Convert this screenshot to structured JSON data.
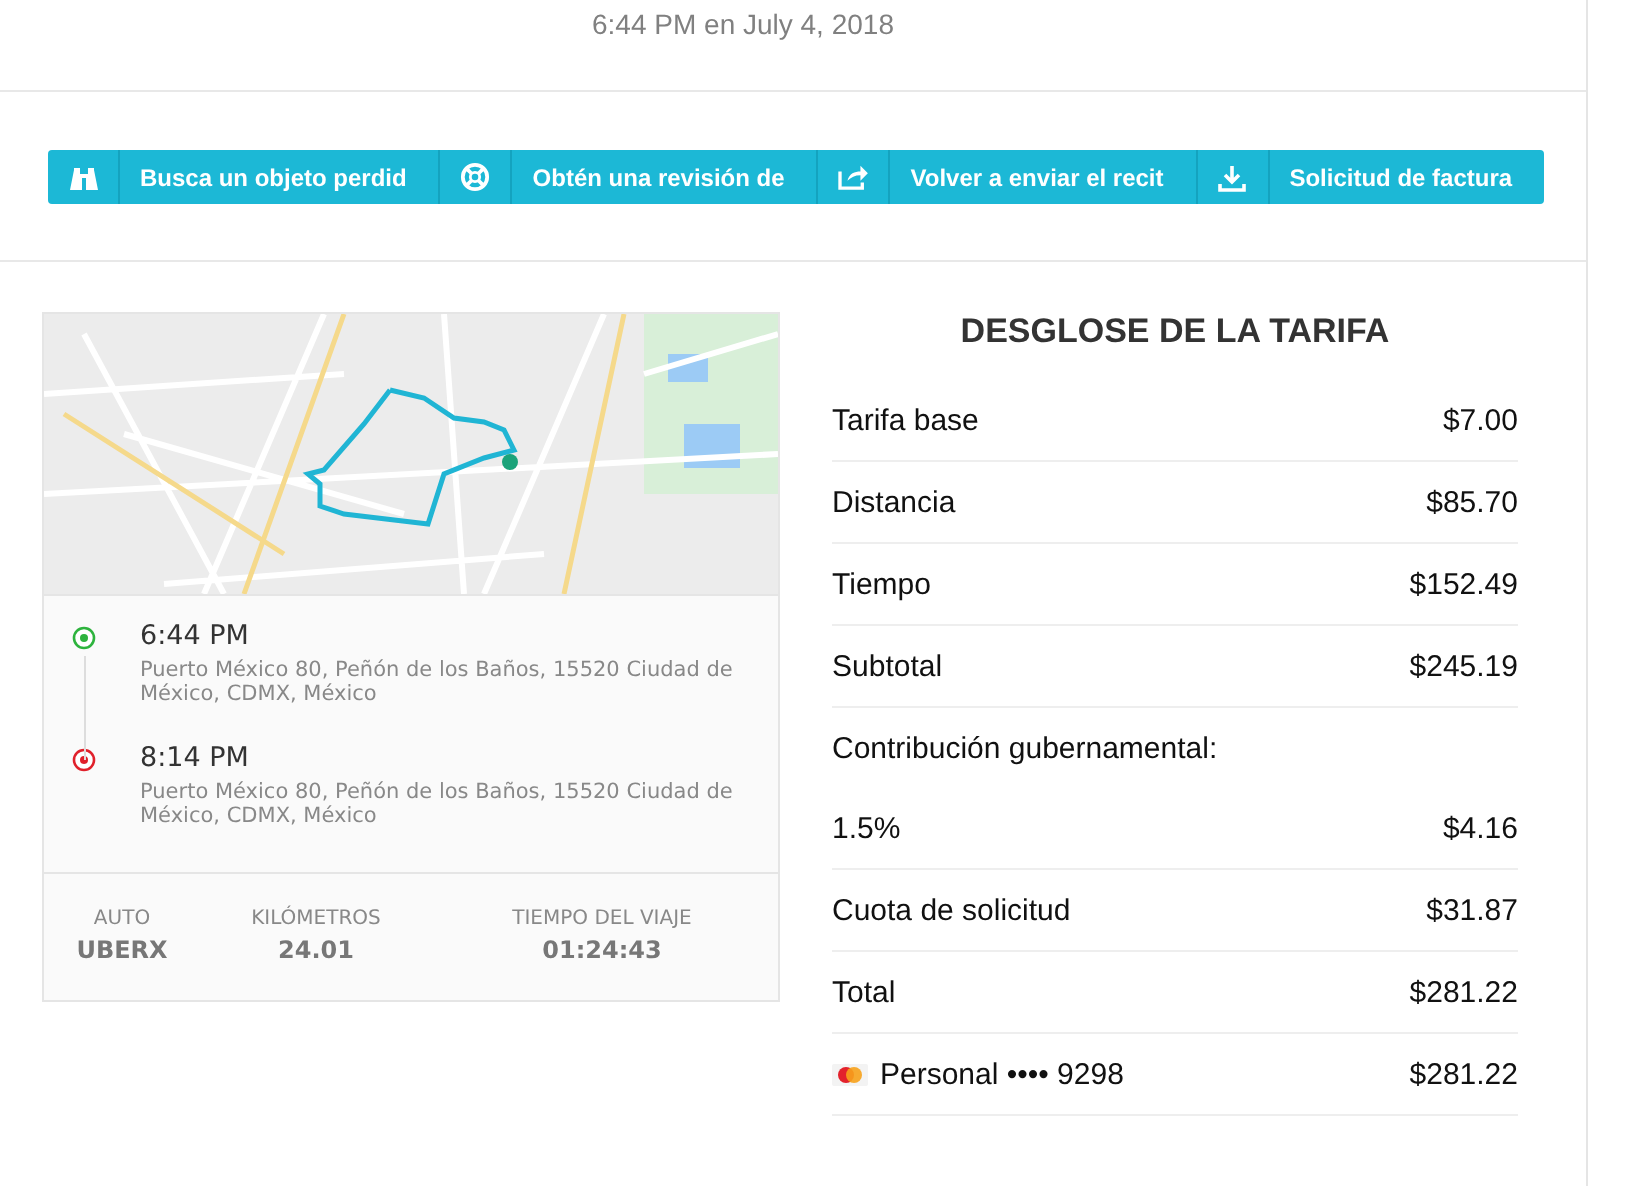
{
  "trip_date": "6:44 PM en July 4, 2018",
  "actions": [
    {
      "label": "Busca un objeto perdid"
    },
    {
      "label": "Obtén una revisión de"
    },
    {
      "label": "Volver a enviar el recit"
    },
    {
      "label": "Solicitud de factura"
    }
  ],
  "trip": {
    "stops": [
      {
        "time": "6:44 PM",
        "address": "Puerto México 80, Peñón de los Baños, 15520 Ciudad de México, CDMX, México",
        "kind": "pickup"
      },
      {
        "time": "8:14 PM",
        "address": "Puerto México 80, Peñón de los Baños, 15520 Ciudad de México, CDMX, México",
        "kind": "dropoff"
      }
    ],
    "stats": [
      {
        "label": "AUTO",
        "value": "UBERX"
      },
      {
        "label": "KILÓMETROS",
        "value": "24.01"
      },
      {
        "label": "TIEMPO DEL VIAJE",
        "value": "01:24:43"
      }
    ]
  },
  "fare": {
    "title": "DESGLOSE DE LA TARIFA",
    "rows": [
      {
        "kind": "line",
        "label": "Tarifa base",
        "amount": "$7.00"
      },
      {
        "kind": "line",
        "label": "Distancia",
        "amount": "$85.70"
      },
      {
        "kind": "line",
        "label": "Tiempo",
        "amount": "$152.49"
      },
      {
        "kind": "line",
        "label": "Subtotal",
        "amount": "$245.19"
      },
      {
        "kind": "heading",
        "label": "Contribución gubernamental:"
      },
      {
        "kind": "line",
        "label": "1.5%",
        "amount": "$4.16"
      },
      {
        "kind": "line",
        "label": "Cuota de solicitud",
        "amount": "$31.87"
      },
      {
        "kind": "line",
        "label": "Total",
        "amount": "$281.22"
      },
      {
        "kind": "payment",
        "label": "Personal •••• 9298",
        "amount": "$281.22"
      }
    ]
  }
}
